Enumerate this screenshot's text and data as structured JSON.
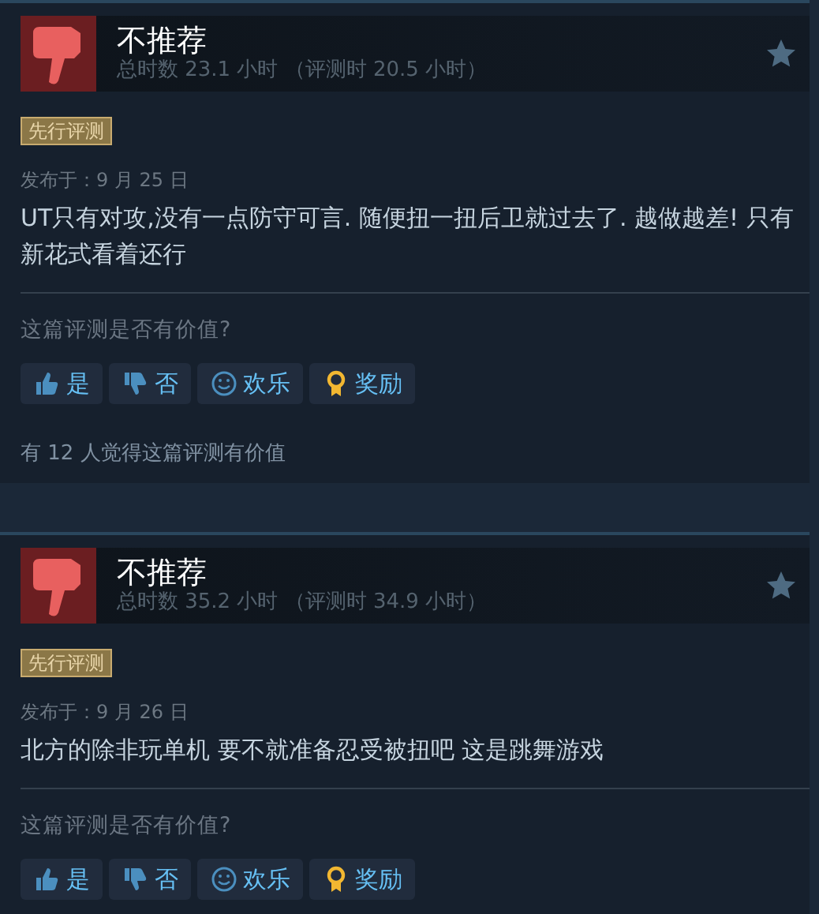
{
  "reviews": [
    {
      "recommended": false,
      "verdict": "不推荐",
      "hours": "总时数 23.1 小时 （评测时 20.5 小时）",
      "badge": "先行评测",
      "posted": "发布于：9 月 25 日",
      "text": "UT只有对攻,没有一点防守可言. 随便扭一扭后卫就过去了. 越做越差! 只有新花式看着还行",
      "question": "这篇评测是否有价值?",
      "buttons": [
        {
          "kind": "yes",
          "label": "是"
        },
        {
          "kind": "no",
          "label": "否"
        },
        {
          "kind": "funny",
          "label": "欢乐"
        },
        {
          "kind": "award",
          "label": "奖励"
        }
      ],
      "helpful": "有 12 人觉得这篇评测有价值"
    },
    {
      "recommended": false,
      "verdict": "不推荐",
      "hours": "总时数 35.2 小时 （评测时 34.9 小时）",
      "badge": "先行评测",
      "posted": "发布于：9 月 26 日",
      "text": "北方的除非玩单机 要不就准备忍受被扭吧 这是跳舞游戏",
      "question": "这篇评测是否有价值?",
      "buttons": [
        {
          "kind": "yes",
          "label": "是"
        },
        {
          "kind": "no",
          "label": "否"
        },
        {
          "kind": "funny",
          "label": "欢乐"
        },
        {
          "kind": "award",
          "label": "奖励"
        }
      ]
    }
  ]
}
